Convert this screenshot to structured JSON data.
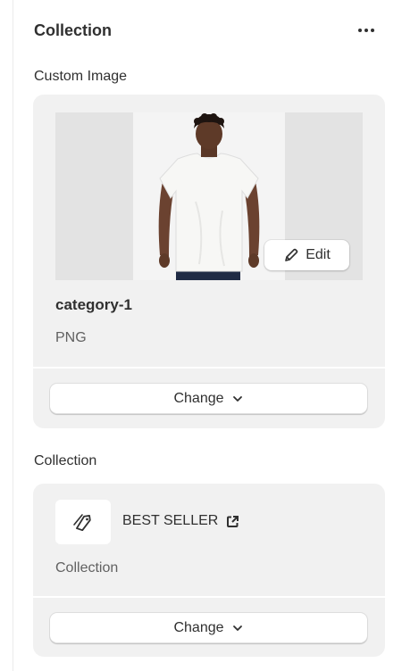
{
  "header": {
    "title": "Collection",
    "more_label": "More actions"
  },
  "custom_image": {
    "section_label": "Custom Image",
    "edit_label": "Edit",
    "file_name": "category-1",
    "file_type": "PNG",
    "change_label": "Change"
  },
  "collection": {
    "section_label": "Collection",
    "name": "BEST SELLER",
    "subtitle": "Collection",
    "change_label": "Change"
  },
  "colors": {
    "card_bg": "#f1f1f1",
    "text": "#303030",
    "muted_text": "#616161",
    "image_bg": "#e3e3e3"
  },
  "icons": [
    "more-horizontal-icon",
    "pencil-icon",
    "chevron-down-icon",
    "tag-icon",
    "external-link-icon"
  ]
}
